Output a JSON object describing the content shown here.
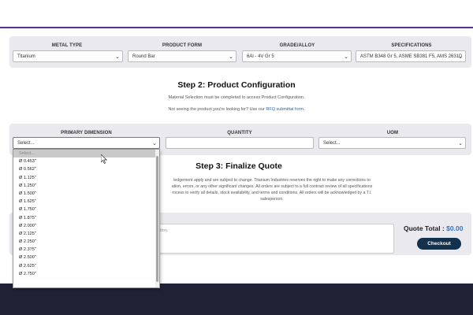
{
  "step1": {
    "columns": [
      {
        "label": "METAL TYPE",
        "value": "Titanium"
      },
      {
        "label": "PRODUCT FORM",
        "value": "Round Bar"
      },
      {
        "label": "GRADE/ALLOY",
        "value": "6Al - 4V Gr 5"
      },
      {
        "label": "SPECIFICATIONS",
        "value": "ASTM B348 Gr 5, ASME SB381 F5, AMS 2631D"
      }
    ]
  },
  "step2": {
    "title": "Step 2: Product Configuration",
    "notice1": "Material Selection must be completed to access Product Configuration.",
    "notice2_prefix": "Not seeing the product you're looking for? Use our ",
    "notice2_link": "RFQ submittal form",
    "notice2_suffix": ".",
    "columns": {
      "primary_dimension": {
        "label": "PRIMARY DIMENSION",
        "value": "Select..."
      },
      "quantity": {
        "label": "QUANTITY",
        "value": ""
      },
      "uom": {
        "label": "UOM",
        "value": "Select..."
      }
    },
    "dropdown_options": [
      "Select...",
      "Ø 0.453\"",
      "Ø 0.562\"",
      "Ø 1.125\"",
      "Ø 1.250\"",
      "Ø 1.500\"",
      "Ø 1.625\"",
      "Ø 1.750\"",
      "Ø 1.875\"",
      "Ø 2.000\"",
      "Ø 2.125\"",
      "Ø 2.250\"",
      "Ø 2.375\"",
      "Ø 2.500\"",
      "Ø 2.625\"",
      "Ø 2.750\""
    ]
  },
  "step3": {
    "title": "Step 3: Finalize Quote",
    "disclaimer_line1": "ledgement apply and are subject to change. Titanium Industries reserves the right to make any corrections to",
    "disclaimer_line2": "ation, errors, or any other significant changes. All orders are subject to a full contract review of all specifications",
    "disclaimer_line3": "rocess to verify all details, stock availability, and terms and conditions. All orders will be acknowledged by a T.I.",
    "disclaimer_line4": "salesperson.",
    "comments_placeholder": "ation.",
    "quote_total_label": "Quote Total : ",
    "quote_total_value": "$0.00",
    "checkout_label": "Checkout"
  },
  "colors": {
    "accent": "#5b2d8e",
    "link": "#2b5fb3",
    "button": "#13304d",
    "footer": "#1f2235",
    "panel": "#e9e9ee"
  }
}
